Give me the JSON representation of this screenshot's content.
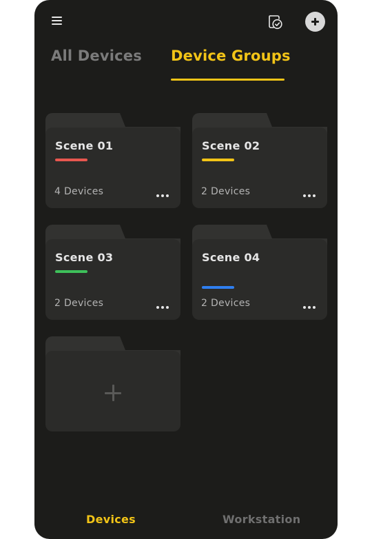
{
  "topbar": {
    "menu_icon": "hamburger-menu-icon",
    "history_icon": "history-check-icon",
    "add_icon": "plus-circle-icon"
  },
  "tabs": [
    {
      "label": "All Devices",
      "active": false
    },
    {
      "label": "Device Groups",
      "active": true
    }
  ],
  "groups": [
    {
      "name": "Scene 01",
      "count": "4 Devices",
      "color": "#e8574f"
    },
    {
      "name": "Scene 02",
      "count": "2 Devices",
      "color": "#f2c417"
    },
    {
      "name": "Scene 03",
      "count": "2 Devices",
      "color": "#3ec05a"
    },
    {
      "name": "Scene 04",
      "count": "2 Devices",
      "color": "#2f7ff0"
    }
  ],
  "add_group": {
    "icon": "plus-icon"
  },
  "bottom_nav": [
    {
      "label": "Devices",
      "active": true
    },
    {
      "label": "Workstation",
      "active": false
    }
  ],
  "colors": {
    "accent": "#f2c417",
    "background": "#1c1c1a",
    "card": "#2b2b29"
  }
}
